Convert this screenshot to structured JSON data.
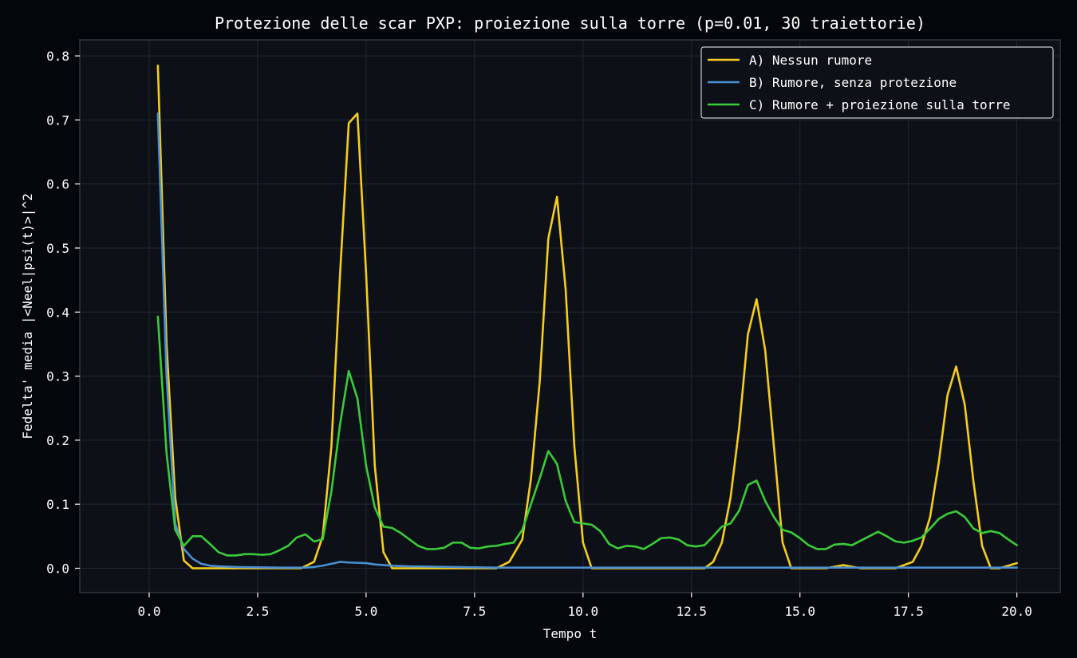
{
  "colors": {
    "figure_background": "#03060b",
    "plot_background": "#0d1117",
    "grid": "#1f2733",
    "spine": "#30363d",
    "text": "#ffffff",
    "legend_border": "#c9cdd3"
  },
  "chart_data": {
    "type": "line",
    "title": "Protezione delle scar PXP: proiezione sulla torre (p=0.01, 30 traiettorie)",
    "xlabel": "Tempo t",
    "ylabel": "Fedelta' media |<Neel|psi(t)>|^2",
    "xlim": [
      -1.6,
      21.0
    ],
    "ylim": [
      -0.038,
      0.825
    ],
    "xticks": [
      0.0,
      2.5,
      5.0,
      7.5,
      10.0,
      12.5,
      15.0,
      17.5,
      20.0
    ],
    "xtick_labels": [
      "0.0",
      "2.5",
      "5.0",
      "7.5",
      "10.0",
      "12.5",
      "15.0",
      "17.5",
      "20.0"
    ],
    "yticks": [
      0.0,
      0.1,
      0.2,
      0.3,
      0.4,
      0.5,
      0.6,
      0.7,
      0.8
    ],
    "ytick_labels": [
      "0.0",
      "0.1",
      "0.2",
      "0.3",
      "0.4",
      "0.5",
      "0.6",
      "0.7",
      "0.8"
    ],
    "grid": true,
    "legend_position": "top-right",
    "series": [
      {
        "name": "A) Nessun rumore",
        "color": "#f5cd1d",
        "x": [
          0.2,
          0.4,
          0.6,
          0.8,
          1.0,
          1.2,
          1.4,
          1.6,
          2.0,
          2.5,
          3.0,
          3.5,
          3.8,
          4.0,
          4.2,
          4.4,
          4.6,
          4.8,
          5.0,
          5.2,
          5.4,
          5.6,
          6.0,
          7.0,
          8.0,
          8.3,
          8.6,
          8.8,
          9.0,
          9.2,
          9.4,
          9.6,
          9.8,
          10.0,
          10.2,
          10.5,
          11.0,
          12.0,
          12.8,
          13.0,
          13.2,
          13.4,
          13.6,
          13.8,
          14.0,
          14.2,
          14.4,
          14.6,
          14.8,
          15.2,
          15.6,
          16.0,
          16.4,
          16.8,
          17.2,
          17.6,
          17.8,
          18.0,
          18.2,
          18.4,
          18.6,
          18.8,
          19.0,
          19.2,
          19.4,
          19.6,
          20.0
        ],
        "y": [
          0.785,
          0.35,
          0.11,
          0.012,
          0.0,
          0.0,
          0.0,
          0.0,
          0.0,
          0.0,
          0.0,
          0.0,
          0.01,
          0.05,
          0.19,
          0.46,
          0.695,
          0.71,
          0.46,
          0.16,
          0.025,
          0.0,
          0.0,
          0.0,
          0.0,
          0.01,
          0.045,
          0.14,
          0.29,
          0.515,
          0.58,
          0.435,
          0.19,
          0.04,
          0.0,
          0.0,
          0.0,
          0.0,
          0.0,
          0.01,
          0.04,
          0.11,
          0.22,
          0.365,
          0.42,
          0.34,
          0.19,
          0.04,
          0.0,
          0.0,
          0.0,
          0.005,
          0.0,
          0.0,
          0.0,
          0.01,
          0.035,
          0.08,
          0.165,
          0.27,
          0.315,
          0.255,
          0.135,
          0.035,
          0.0,
          0.0,
          0.008
        ]
      },
      {
        "name": "B) Rumore, senza protezione",
        "color": "#4a8fd0",
        "x": [
          0.2,
          0.4,
          0.6,
          0.8,
          1.0,
          1.2,
          1.4,
          1.6,
          2.0,
          3.0,
          3.6,
          3.8,
          4.0,
          4.2,
          4.4,
          4.6,
          5.0,
          5.2,
          5.6,
          6.0,
          7.0,
          8.0,
          9.0,
          10.0,
          11.0,
          12.0,
          13.0,
          14.0,
          15.0,
          16.0,
          17.0,
          18.0,
          19.0,
          20.0
        ],
        "y": [
          0.71,
          0.3,
          0.07,
          0.03,
          0.015,
          0.007,
          0.004,
          0.003,
          0.002,
          0.001,
          0.001,
          0.002,
          0.004,
          0.007,
          0.01,
          0.009,
          0.008,
          0.006,
          0.004,
          0.003,
          0.002,
          0.001,
          0.001,
          0.001,
          0.001,
          0.001,
          0.001,
          0.001,
          0.001,
          0.001,
          0.001,
          0.001,
          0.001,
          0.001
        ]
      },
      {
        "name": "C) Rumore + proiezione sulla torre",
        "color": "#3acb3a",
        "x": [
          0.2,
          0.4,
          0.6,
          0.8,
          1.0,
          1.2,
          1.4,
          1.6,
          1.8,
          2.0,
          2.2,
          2.4,
          2.6,
          2.8,
          3.0,
          3.2,
          3.4,
          3.6,
          3.8,
          4.0,
          4.2,
          4.4,
          4.6,
          4.8,
          5.0,
          5.2,
          5.4,
          5.6,
          5.8,
          6.0,
          6.2,
          6.4,
          6.6,
          6.8,
          7.0,
          7.2,
          7.4,
          7.6,
          7.8,
          8.0,
          8.2,
          8.4,
          8.6,
          8.8,
          9.0,
          9.2,
          9.4,
          9.6,
          9.8,
          10.0,
          10.2,
          10.4,
          10.6,
          10.8,
          11.0,
          11.2,
          11.4,
          11.6,
          11.8,
          12.0,
          12.2,
          12.4,
          12.6,
          12.8,
          13.0,
          13.2,
          13.4,
          13.6,
          13.8,
          14.0,
          14.2,
          14.4,
          14.6,
          14.8,
          15.0,
          15.2,
          15.4,
          15.6,
          15.8,
          16.0,
          16.2,
          16.4,
          16.6,
          16.8,
          17.0,
          17.2,
          17.4,
          17.6,
          17.8,
          18.0,
          18.2,
          18.4,
          18.6,
          18.8,
          19.0,
          19.2,
          19.4,
          19.6,
          19.8,
          20.0
        ],
        "y": [
          0.393,
          0.18,
          0.06,
          0.035,
          0.05,
          0.05,
          0.038,
          0.025,
          0.02,
          0.02,
          0.022,
          0.022,
          0.021,
          0.022,
          0.028,
          0.035,
          0.048,
          0.053,
          0.042,
          0.045,
          0.12,
          0.225,
          0.308,
          0.265,
          0.16,
          0.095,
          0.065,
          0.063,
          0.055,
          0.045,
          0.035,
          0.03,
          0.03,
          0.032,
          0.04,
          0.04,
          0.032,
          0.031,
          0.034,
          0.035,
          0.038,
          0.04,
          0.06,
          0.1,
          0.14,
          0.183,
          0.163,
          0.105,
          0.072,
          0.07,
          0.068,
          0.058,
          0.038,
          0.031,
          0.035,
          0.034,
          0.03,
          0.038,
          0.047,
          0.048,
          0.045,
          0.036,
          0.034,
          0.036,
          0.05,
          0.065,
          0.07,
          0.09,
          0.13,
          0.137,
          0.105,
          0.08,
          0.06,
          0.056,
          0.047,
          0.036,
          0.03,
          0.03,
          0.037,
          0.038,
          0.036,
          0.043,
          0.05,
          0.057,
          0.05,
          0.042,
          0.04,
          0.043,
          0.048,
          0.062,
          0.077,
          0.085,
          0.089,
          0.08,
          0.062,
          0.055,
          0.058,
          0.055,
          0.045,
          0.036
        ]
      }
    ]
  }
}
